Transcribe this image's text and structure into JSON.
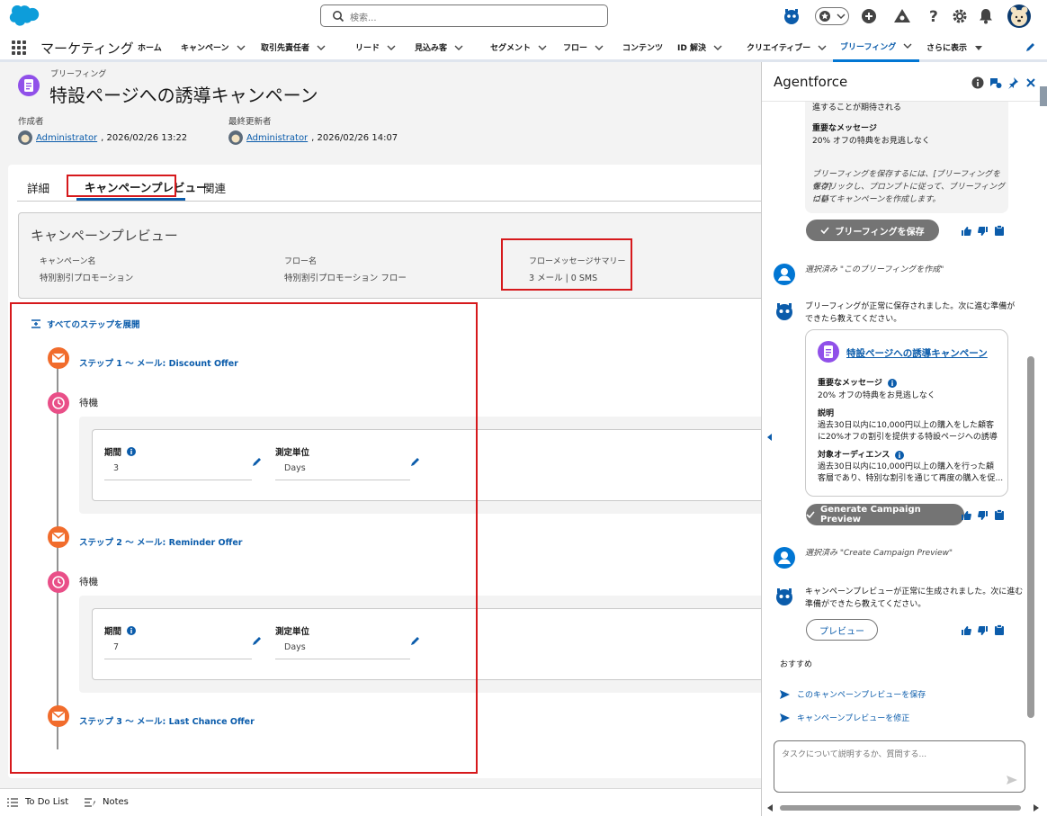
{
  "header": {
    "search_placeholder": "検索..."
  },
  "nav": {
    "app_name": "マーケティング",
    "items": [
      {
        "label": "ホーム",
        "chevron": false
      },
      {
        "label": "キャンペーン",
        "chevron": true
      },
      {
        "label": "取引先責任者",
        "chevron": true
      },
      {
        "label": "リード",
        "chevron": true
      },
      {
        "label": "見込み客",
        "chevron": true
      },
      {
        "label": "セグメント",
        "chevron": true
      },
      {
        "label": "フロー",
        "chevron": true
      },
      {
        "label": "コンテンツ",
        "chevron": false
      },
      {
        "label": "ID 解決",
        "chevron": true
      },
      {
        "label": "クリエイティブー",
        "chevron": true
      },
      {
        "label": "ブリーフィング",
        "chevron": true,
        "active": true
      },
      {
        "label": "さらに表示",
        "chevron": true
      }
    ]
  },
  "record": {
    "object_label": "ブリーフィング",
    "title": "特設ページへの誘導キャンペーン",
    "created_by_label": "作成者",
    "created_by": "Administrator",
    "created_at": ", 2026/02/26 13:22",
    "modified_by_label": "最終更新者",
    "modified_by": "Administrator",
    "modified_at": ", 2026/02/26 14:07"
  },
  "tabs": [
    {
      "label": "詳細"
    },
    {
      "label": "キャンペーンプレビュー",
      "active": true
    },
    {
      "label": "関連"
    }
  ],
  "preview": {
    "title": "キャンペーンプレビュー",
    "campaign_name_label": "キャンペーン名",
    "campaign_name": "特別割引プロモーション",
    "flow_name_label": "フロー名",
    "flow_name": "特別割引プロモーション フロー",
    "flow_summary_label": "フローメッセージサマリー",
    "flow_summary": "3 メール | 0 SMS"
  },
  "flow": {
    "expand_all": "すべてのステップを展開",
    "steps": [
      {
        "label": "ステップ 1 〜 メール: Discount Offer"
      },
      {
        "label": "ステップ 2 〜 メール: Reminder Offer"
      },
      {
        "label": "ステップ 3 〜 メール: Last Chance Offer"
      }
    ],
    "waits": [
      {
        "label": "待機",
        "period_label": "期間",
        "period": "3",
        "unit_label": "測定単位",
        "unit": "Days"
      },
      {
        "label": "待機",
        "period_label": "期間",
        "period": "7",
        "unit_label": "測定単位",
        "unit": "Days"
      }
    ]
  },
  "utility": {
    "todo": "To Do List",
    "notes": "Notes"
  },
  "agent": {
    "title": "Agentforce",
    "msg1_line1": "進することが期待される",
    "msg1_key_label": "重要なメッセージ",
    "msg1_key": "20% オフの特典をお見逃しなく",
    "msg1_note1": "ブリーフィングを保存するには、[ブリーフィングを保存]",
    "msg1_note2": "をクリックし、プロンプトに従って、ブリーフィングに基",
    "msg1_note3": "づいてキャンペーンを作成します。",
    "save_btn": "ブリーフィングを保存",
    "user1": "選択済み \"このブリーフィングを作成\"",
    "bot2_line1": "ブリーフィングが正常に保存されました。次に進む準備が",
    "bot2_line2": "できたら教えてください。",
    "card_title": "特設ページへの誘導キャンペーン",
    "card_key_label": "重要なメッセージ",
    "card_key": "20% オフの特典をお見逃しなく",
    "card_desc_label": "説明",
    "card_desc1": "過去30日以内に10,000円以上の購入をした顧客",
    "card_desc2": "に20%オフの割引を提供する特設ページへの誘導",
    "card_aud_label": "対象オーディエンス",
    "card_aud1": "過去30日以内に10,000円以上の購入を行った顧",
    "card_aud2": "客層であり、特別な割引を通じて再度の購入を促...",
    "gen_btn": "Generate Campaign Preview",
    "user2": "選択済み \"Create Campaign Preview\"",
    "bot3_line1": "キャンペーンプレビューが正常に生成されました。次に進む",
    "bot3_line2": "準備ができたら教えてください。",
    "preview_btn": "プレビュー",
    "recommend": "おすすめ",
    "sugg1": "このキャンペーンプレビューを保存",
    "sugg2": "キャンペーンプレビューを修正",
    "input_placeholder": "タスクについて説明するか、質問する..."
  }
}
